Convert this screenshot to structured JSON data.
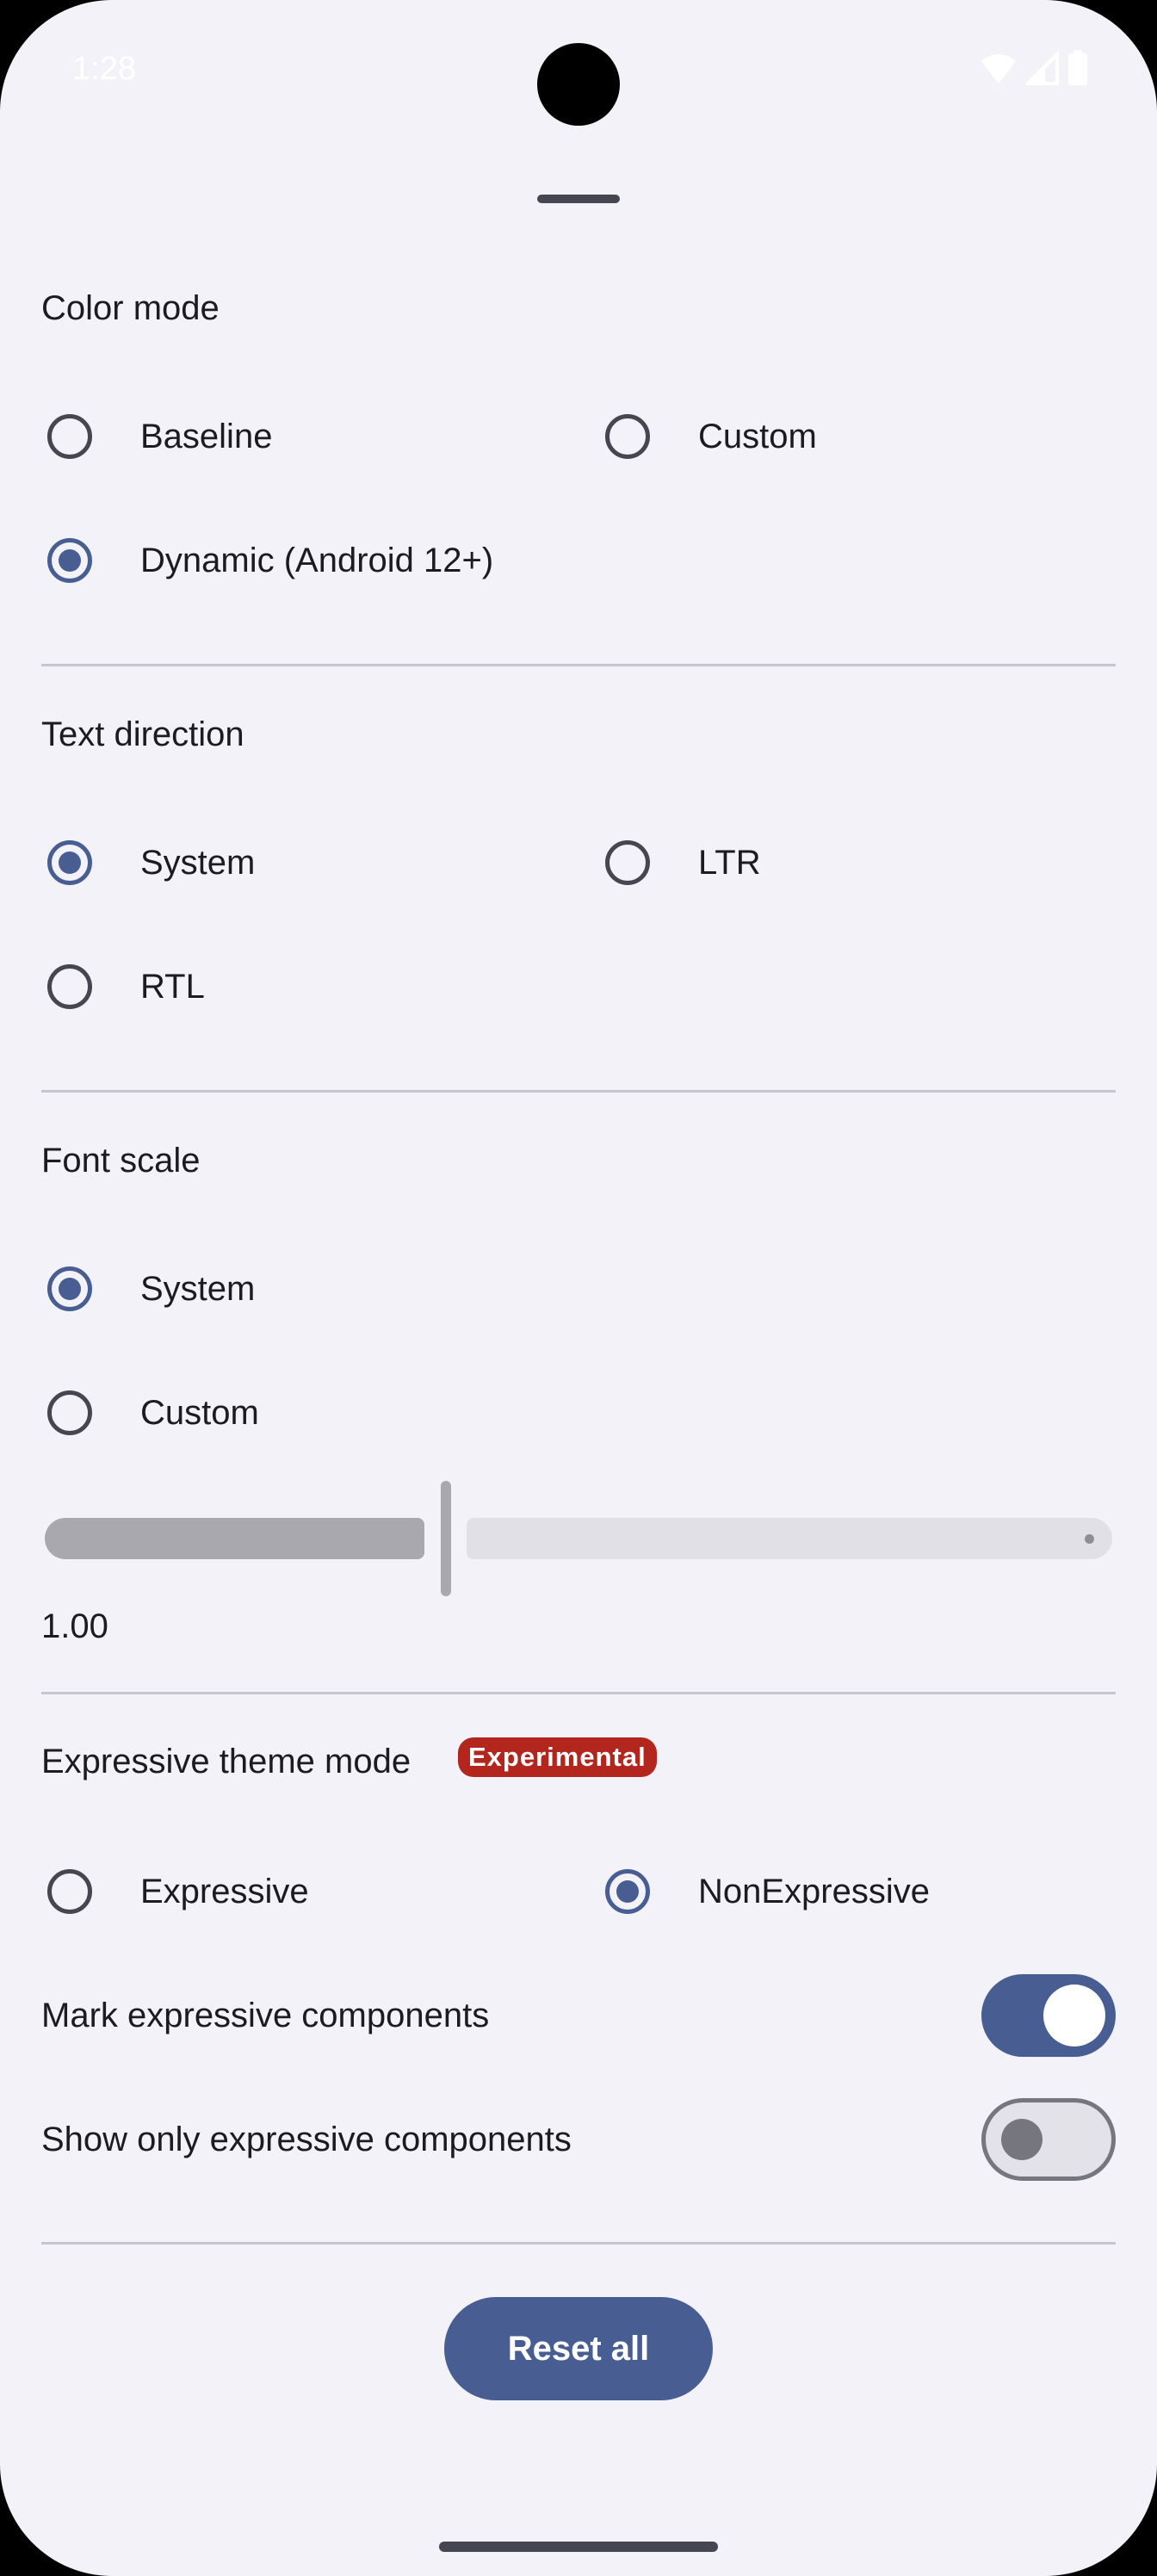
{
  "status_bar": {
    "time": "1:28",
    "icons": [
      "wifi-icon",
      "cellular-signal-icon",
      "battery-icon"
    ]
  },
  "color_mode": {
    "title": "Color mode",
    "options": [
      {
        "label": "Baseline",
        "selected": false
      },
      {
        "label": "Custom",
        "selected": false
      },
      {
        "label": "Dynamic (Android 12+)",
        "selected": true
      }
    ]
  },
  "text_direction": {
    "title": "Text direction",
    "options": [
      {
        "label": "System",
        "selected": true
      },
      {
        "label": "LTR",
        "selected": false
      },
      {
        "label": "RTL",
        "selected": false
      }
    ]
  },
  "font_scale": {
    "title": "Font scale",
    "options": [
      {
        "label": "System",
        "selected": true
      },
      {
        "label": "Custom",
        "selected": false
      }
    ],
    "slider_value": "1.00",
    "slider_fraction": 0.37
  },
  "expressive_theme": {
    "title": "Expressive theme mode",
    "badge": "Experimental",
    "options": [
      {
        "label": "Expressive",
        "selected": false
      },
      {
        "label": "NonExpressive",
        "selected": true
      }
    ],
    "mark_components": {
      "label": "Mark expressive components",
      "checked": true
    },
    "show_only": {
      "label": "Show only expressive components",
      "checked": false
    }
  },
  "reset_label": "Reset all",
  "colors": {
    "primary": "#485d92",
    "background": "#f3f2f8",
    "badge": "#b3261e"
  }
}
